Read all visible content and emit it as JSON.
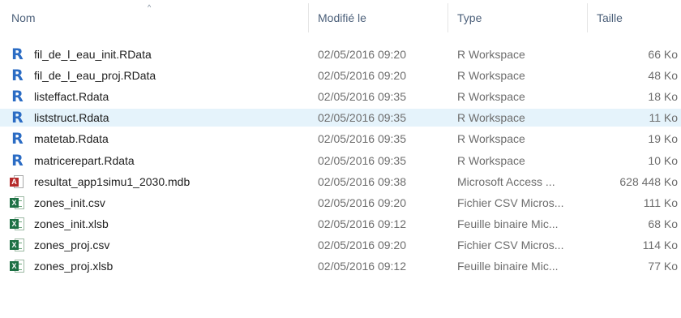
{
  "header": {
    "columns": [
      {
        "label": "Nom"
      },
      {
        "label": "Modifié le"
      },
      {
        "label": "Type"
      },
      {
        "label": "Taille"
      }
    ],
    "sort_indicator": "^"
  },
  "files": [
    {
      "name": "fil_de_l_eau_init.RData",
      "modified": "02/05/2016 09:20",
      "type": "R Workspace",
      "size": "66 Ko",
      "icon": "r-icon"
    },
    {
      "name": "fil_de_l_eau_proj.RData",
      "modified": "02/05/2016 09:20",
      "type": "R Workspace",
      "size": "48 Ko",
      "icon": "r-icon"
    },
    {
      "name": "listeffact.Rdata",
      "modified": "02/05/2016 09:35",
      "type": "R Workspace",
      "size": "18 Ko",
      "icon": "r-icon"
    },
    {
      "name": "liststruct.Rdata",
      "modified": "02/05/2016 09:35",
      "type": "R Workspace",
      "size": "11 Ko",
      "icon": "r-icon",
      "selected": true
    },
    {
      "name": "matetab.Rdata",
      "modified": "02/05/2016 09:35",
      "type": "R Workspace",
      "size": "19 Ko",
      "icon": "r-icon"
    },
    {
      "name": "matricerepart.Rdata",
      "modified": "02/05/2016 09:35",
      "type": "R Workspace",
      "size": "10 Ko",
      "icon": "r-icon"
    },
    {
      "name": "resultat_app1simu1_2030.mdb",
      "modified": "02/05/2016 09:38",
      "type": "Microsoft Access ...",
      "size": "628 448 Ko",
      "icon": "access-icon"
    },
    {
      "name": "zones_init.csv",
      "modified": "02/05/2016 09:20",
      "type": "Fichier CSV Micros...",
      "size": "111 Ko",
      "icon": "excel-icon"
    },
    {
      "name": "zones_init.xlsb",
      "modified": "02/05/2016 09:12",
      "type": "Feuille binaire Mic...",
      "size": "68 Ko",
      "icon": "excel-icon"
    },
    {
      "name": "zones_proj.csv",
      "modified": "02/05/2016 09:20",
      "type": "Fichier CSV Micros...",
      "size": "114 Ko",
      "icon": "excel-icon"
    },
    {
      "name": "zones_proj.xlsb",
      "modified": "02/05/2016 09:12",
      "type": "Feuille binaire Mic...",
      "size": "77 Ko",
      "icon": "excel-icon"
    }
  ],
  "colors": {
    "selected_row": "#e5f3fb",
    "header_text": "#4c607a",
    "r_icon": "#2b6cc4",
    "access_icon": "#b52b2b",
    "excel_icon": "#1d7044"
  }
}
